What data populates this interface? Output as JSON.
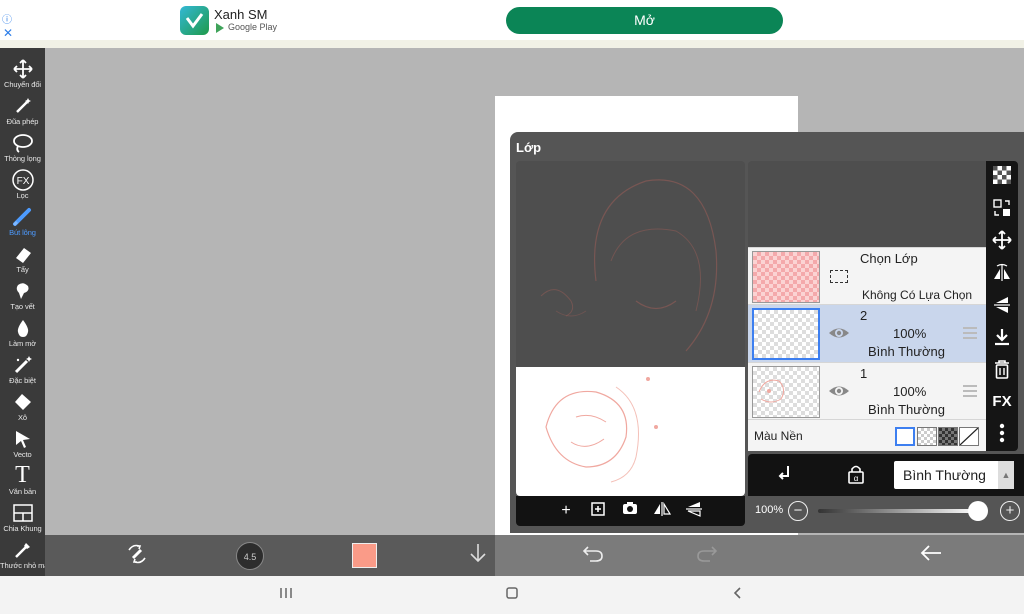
{
  "ad": {
    "info_icon": "info-icon",
    "close_icon": "close-icon",
    "app_name": "Xanh SM",
    "store": "Google Play",
    "open_button": "Mở"
  },
  "toolbar": {
    "items": [
      {
        "label": "Chuyển đổi",
        "icon": "move-arrows-icon"
      },
      {
        "label": "Đũa phép",
        "icon": "magic-wand-icon"
      },
      {
        "label": "Thòng lọng",
        "icon": "lasso-icon"
      },
      {
        "label": "Lọc",
        "icon": "fx-icon"
      },
      {
        "label": "Bút lông",
        "icon": "brush-icon",
        "active": true
      },
      {
        "label": "Tẩy",
        "icon": "eraser-icon"
      },
      {
        "label": "Tạo vết",
        "icon": "smudge-icon"
      },
      {
        "label": "Làm mờ",
        "icon": "blur-drop-icon"
      },
      {
        "label": "Đặc biệt",
        "icon": "special-brush-icon"
      },
      {
        "label": "Xô",
        "icon": "bucket-icon"
      },
      {
        "label": "Vecto",
        "icon": "vector-cursor-icon"
      },
      {
        "label": "Văn bản",
        "icon": "text-icon"
      },
      {
        "label": "Chia Khung",
        "icon": "frame-divider-icon"
      },
      {
        "label": "Thước nhỏ mắt",
        "icon": "eyedropper-icon"
      }
    ]
  },
  "layer_panel": {
    "title": "Lớp",
    "selection_layer": {
      "title": "Chọn Lớp",
      "subtitle": "Không Có Lựa Chọn"
    },
    "layers": [
      {
        "number": "2",
        "opacity": "100%",
        "mode": "Bình Thường",
        "selected": true
      },
      {
        "number": "1",
        "opacity": "100%",
        "mode": "Bình Thường",
        "selected": false
      }
    ],
    "background": {
      "label": "Màu Nền",
      "swatches": [
        "white",
        "checker-light",
        "checker-dark",
        "none"
      ]
    },
    "blend_mode": "Bình Thường",
    "opacity_label": "100%",
    "opacity_value": 1.0
  },
  "bottom_bar": {
    "brush_size": "4.5",
    "color": "#fa9b88",
    "layer_count": "2"
  },
  "colors": {
    "accent": "#4d9bff",
    "ad_button": "#0b8556",
    "selected_layer": "#c9d6ec"
  }
}
